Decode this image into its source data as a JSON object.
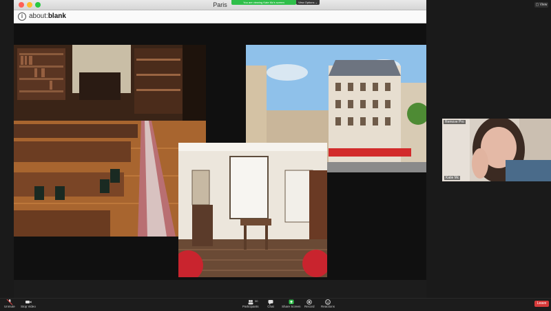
{
  "window": {
    "title": "Paris"
  },
  "share_banner": {
    "text": "You are viewing Kate Mc's screen",
    "view_options": "View Options ⌄"
  },
  "address_bar": {
    "scheme": "about:",
    "page": "blank"
  },
  "view_button": "▢ View",
  "participant": {
    "name": "Katie Mc",
    "tag": "Remove Pro"
  },
  "toolbar": {
    "unmute": "Unmute",
    "stop_video": "Stop Video",
    "participants": "Participants",
    "participants_count": "30",
    "chat": "Chat",
    "share_screen": "Share Screen",
    "record": "Record",
    "reactions": "Reactions",
    "leave": "Leave"
  },
  "colors": {
    "share_green": "#2fbf4a",
    "leave_red": "#d63a3a",
    "toolbar_bg": "#1c1c1c"
  }
}
